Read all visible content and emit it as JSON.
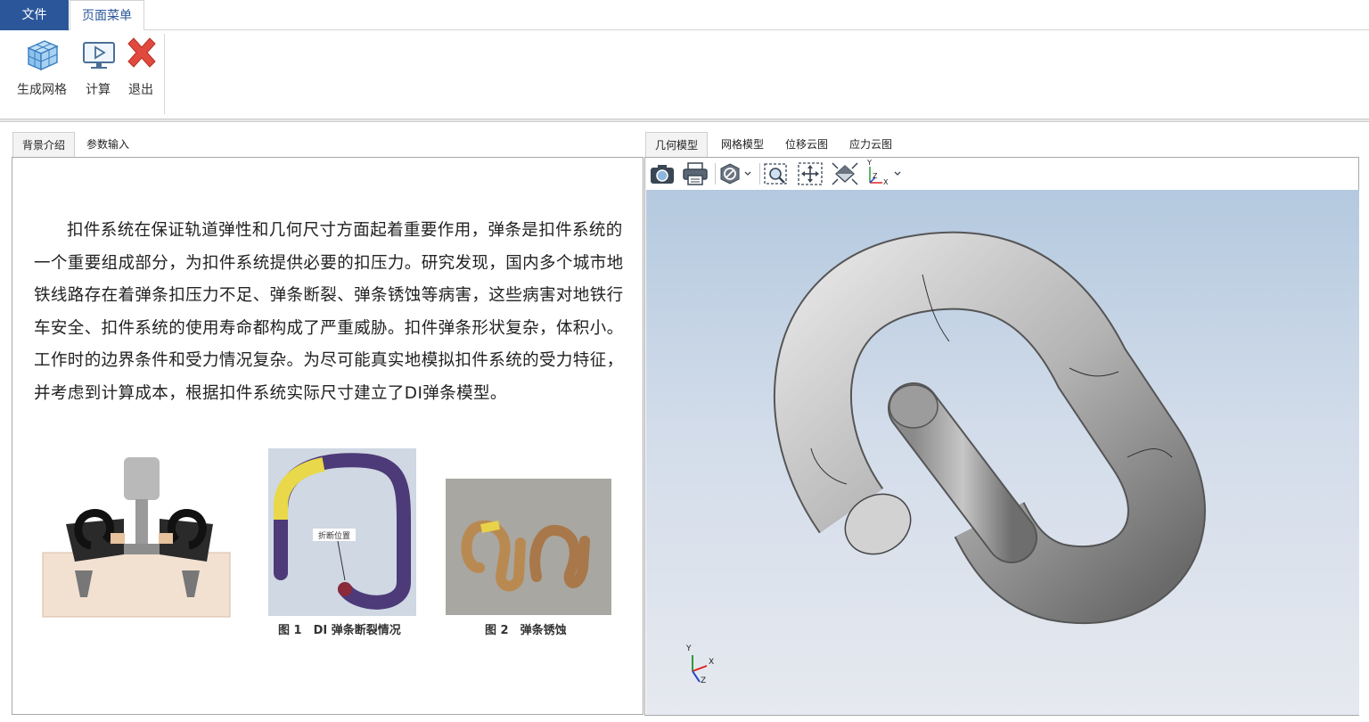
{
  "ribbon": {
    "tabs": [
      {
        "label": "文件"
      },
      {
        "label": "页面菜单"
      }
    ],
    "buttons": [
      {
        "label": "生成网格",
        "icon": "mesh-cube-icon"
      },
      {
        "label": "计算",
        "icon": "monitor-play-icon"
      },
      {
        "label": "退出",
        "icon": "close-x-icon"
      }
    ]
  },
  "left_panel": {
    "tabs": [
      {
        "label": "背景介绍"
      },
      {
        "label": "参数输入"
      }
    ],
    "paragraph": "扣件系统在保证轨道弹性和几何尺寸方面起着重要作用，弹条是扣件系统的一个重要组成部分，为扣件系统提供必要的扣压力。研究发现，国内多个城市地铁线路存在着弹条扣压力不足、弹条断裂、弹条锈蚀等病害，这些病害对地铁行车安全、扣件系统的使用寿命都构成了严重威胁。扣件弹条形状复杂，体积小。工作时的边界条件和受力情况复杂。为尽可能真实地模拟扣件系统的受力特征，并考虑到计算成本，根据扣件系统实际尺寸建立了DI弹条模型。",
    "figures": [
      {
        "caption": ""
      },
      {
        "caption": "图 1　DI 弹条断裂情况",
        "inner_label": "折断位置"
      },
      {
        "caption": "图 2　弹条锈蚀"
      }
    ]
  },
  "right_panel": {
    "tabs": [
      {
        "label": "几何模型"
      },
      {
        "label": "网格模型"
      },
      {
        "label": "位移云图"
      },
      {
        "label": "应力云图"
      }
    ],
    "toolbar": [
      "camera-icon",
      "printer-icon",
      "display-mode-icon",
      "zoom-window-icon",
      "pan-icon",
      "fit-all-icon",
      "axis-view-icon"
    ],
    "axis_labels": {
      "x": "X",
      "y": "Y",
      "z": "Z"
    }
  }
}
